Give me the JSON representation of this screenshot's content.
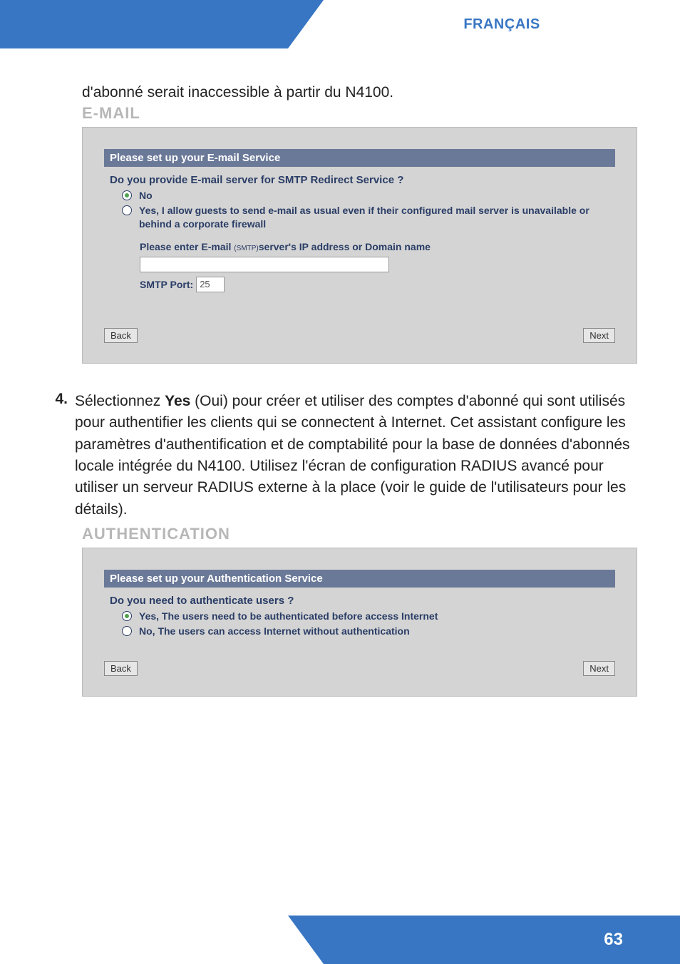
{
  "header": {
    "language": "FRANÇAIS"
  },
  "intro": "d'abonné serait inaccessible à partir du N4100.",
  "email_section": {
    "label": "E-MAIL",
    "panel_title": "Please set up your E-mail Service",
    "question": "Do you provide E-mail server for SMTP Redirect Service ?",
    "options": [
      {
        "label": "No",
        "selected": true
      },
      {
        "label": "Yes, I allow guests to send e-mail as usual even if their configured mail server is unavailable or behind a corporate firewall",
        "selected": false
      }
    ],
    "smtp_prompt_prefix": "Please enter E-mail ",
    "smtp_prompt_small": "(SMTP)",
    "smtp_prompt_suffix": "server's IP address or Domain name",
    "smtp_server_value": "",
    "smtp_port_label": "SMTP Port:",
    "smtp_port_value": "25",
    "back": "Back",
    "next": "Next"
  },
  "step4": {
    "num": "4.",
    "text_pre": "Sélectionnez ",
    "text_bold": "Yes",
    "text_post": " (Oui) pour créer et utiliser des comptes d'abonné qui sont utilisés pour authentifier les clients qui se connectent à Internet. Cet assistant configure les paramètres d'authentification et de comptabilité pour la base de données d'abonnés locale intégrée du N4100. Utilisez l'écran de configuration RADIUS avancé pour utiliser un serveur RADIUS externe à la place (voir le guide de l'utilisateurs pour les détails)."
  },
  "auth_section": {
    "label": "AUTHENTICATION",
    "panel_title": "Please set up your Authentication Service",
    "question": "Do you need to authenticate users ?",
    "options": [
      {
        "label": "Yes, The users need to be authenticated before access Internet",
        "selected": true
      },
      {
        "label": "No, The users can access Internet without authentication",
        "selected": false
      }
    ],
    "back": "Back",
    "next": "Next"
  },
  "footer": {
    "page": "63"
  }
}
